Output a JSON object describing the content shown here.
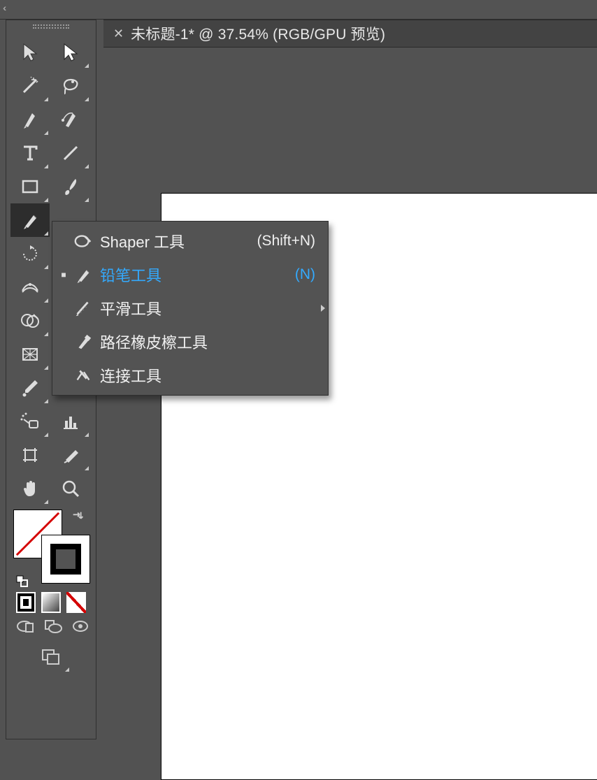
{
  "tab": {
    "title": "未标题-1* @ 37.54% (RGB/GPU 预览)"
  },
  "flyout": {
    "items": [
      {
        "label": "Shaper 工具",
        "shortcut": "(Shift+N)",
        "current": false,
        "icon": "shaper-icon",
        "submenu": false
      },
      {
        "label": "铅笔工具",
        "shortcut": "(N)",
        "current": true,
        "icon": "pencil-icon",
        "submenu": false
      },
      {
        "label": "平滑工具",
        "shortcut": "",
        "current": false,
        "icon": "smooth-icon",
        "submenu": true
      },
      {
        "label": "路径橡皮檫工具",
        "shortcut": "",
        "current": false,
        "icon": "path-eraser-icon",
        "submenu": false
      },
      {
        "label": "连接工具",
        "shortcut": "",
        "current": false,
        "icon": "join-icon",
        "submenu": false
      }
    ]
  },
  "tools": [
    {
      "name": "selection",
      "flyout": false
    },
    {
      "name": "direct-selection",
      "flyout": true
    },
    {
      "name": "magic-wand",
      "flyout": true
    },
    {
      "name": "lasso",
      "flyout": true
    },
    {
      "name": "pen",
      "flyout": true
    },
    {
      "name": "curvature",
      "flyout": false
    },
    {
      "name": "type",
      "flyout": true
    },
    {
      "name": "line-segment",
      "flyout": true
    },
    {
      "name": "rectangle",
      "flyout": true
    },
    {
      "name": "paintbrush",
      "flyout": true
    },
    {
      "name": "pencil",
      "flyout": true,
      "selected": true
    },
    {
      "name": "__flyout_anchor",
      "hidden": true
    },
    {
      "name": "rotate",
      "flyout": true
    },
    {
      "name": "__empty1",
      "hidden": true
    },
    {
      "name": "width",
      "flyout": true
    },
    {
      "name": "__empty2",
      "hidden": true
    },
    {
      "name": "shape-builder",
      "flyout": true
    },
    {
      "name": "__empty3",
      "hidden": true
    },
    {
      "name": "mesh",
      "flyout": true
    },
    {
      "name": "__empty4",
      "hidden": true
    },
    {
      "name": "eyedropper",
      "flyout": true
    },
    {
      "name": "blend",
      "flyout": false
    },
    {
      "name": "symbol-sprayer",
      "flyout": true
    },
    {
      "name": "column-graph",
      "flyout": true
    },
    {
      "name": "artboard",
      "flyout": false
    },
    {
      "name": "slice",
      "flyout": true
    },
    {
      "name": "hand",
      "flyout": true
    },
    {
      "name": "zoom",
      "flyout": false
    }
  ]
}
